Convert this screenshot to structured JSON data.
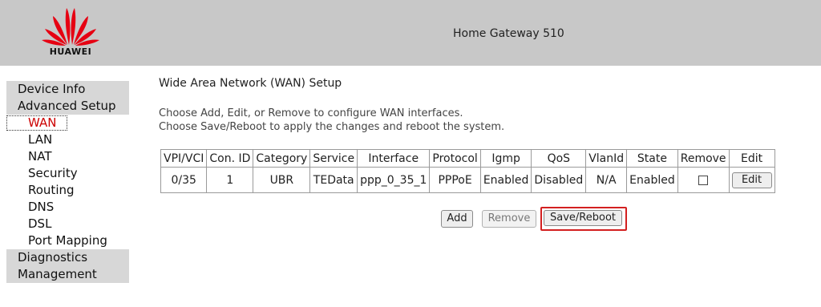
{
  "header": {
    "brand": "HUAWEI",
    "title": "Home Gateway 510",
    "colors": {
      "background": "#c8c8c8",
      "logo_red": "#e60012"
    }
  },
  "nav": {
    "items": [
      {
        "label": "Device Info",
        "level": "main"
      },
      {
        "label": "Advanced Setup",
        "level": "main"
      },
      {
        "label": "WAN",
        "level": "sub",
        "active": true
      },
      {
        "label": "LAN",
        "level": "sub"
      },
      {
        "label": "NAT",
        "level": "sub"
      },
      {
        "label": "Security",
        "level": "sub"
      },
      {
        "label": "Routing",
        "level": "sub"
      },
      {
        "label": "DNS",
        "level": "sub"
      },
      {
        "label": "DSL",
        "level": "sub"
      },
      {
        "label": "Port Mapping",
        "level": "sub"
      },
      {
        "label": "Diagnostics",
        "level": "main"
      },
      {
        "label": "Management",
        "level": "main"
      }
    ]
  },
  "main": {
    "title": "Wide Area Network (WAN) Setup",
    "instructions": [
      "Choose Add, Edit, or Remove to configure WAN interfaces.",
      "Choose Save/Reboot to apply the changes and reboot the system."
    ],
    "table": {
      "headers": [
        "VPI/VCI",
        "Con. ID",
        "Category",
        "Service",
        "Interface",
        "Protocol",
        "Igmp",
        "QoS",
        "VlanId",
        "State",
        "Remove",
        "Edit"
      ],
      "rows": [
        {
          "vpi_vci": "0/35",
          "con_id": "1",
          "category": "UBR",
          "service": "TEData",
          "interface": "ppp_0_35_1",
          "protocol": "PPPoE",
          "igmp": "Enabled",
          "qos": "Disabled",
          "vlanid": "N/A",
          "state": "Enabled",
          "remove_checked": false,
          "edit_label": "Edit"
        }
      ]
    },
    "buttons": {
      "add": "Add",
      "remove": "Remove",
      "save_reboot": "Save/Reboot"
    },
    "highlight_color": "#d32020"
  }
}
